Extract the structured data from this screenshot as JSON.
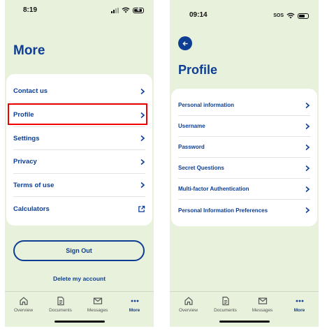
{
  "left_screen": {
    "status": {
      "time": "8:19",
      "battery": "4"
    },
    "title": "More",
    "menu_items": [
      {
        "label": "Contact us"
      },
      {
        "label": "Profile"
      },
      {
        "label": "Settings"
      },
      {
        "label": "Privacy"
      },
      {
        "label": "Terms of use"
      },
      {
        "label": "Calculators",
        "icon": "external-link-icon"
      }
    ],
    "highlighted_item": "Profile",
    "sign_out_label": "Sign Out",
    "delete_account_label": "Delete my account"
  },
  "right_screen": {
    "status": {
      "time": "09:14",
      "sos": "SOS"
    },
    "back_icon": "back-arrow-icon",
    "title": "Profile",
    "menu_items": [
      {
        "label": "Personal information"
      },
      {
        "label": "Username"
      },
      {
        "label": "Password"
      },
      {
        "label": "Secret Questions"
      },
      {
        "label": "Multi-factor Authentication"
      },
      {
        "label": "Personal Information Preferences"
      }
    ]
  },
  "tabbar": {
    "tabs": [
      {
        "label": "Overview",
        "icon": "home-icon"
      },
      {
        "label": "Documents",
        "icon": "document-icon"
      },
      {
        "label": "Messages",
        "icon": "mail-icon"
      },
      {
        "label": "More",
        "icon": "more-dots-icon",
        "active": true
      }
    ]
  },
  "colors": {
    "accent": "#0d3e94",
    "background": "#e8f1dc",
    "highlight": "#ee0000"
  }
}
